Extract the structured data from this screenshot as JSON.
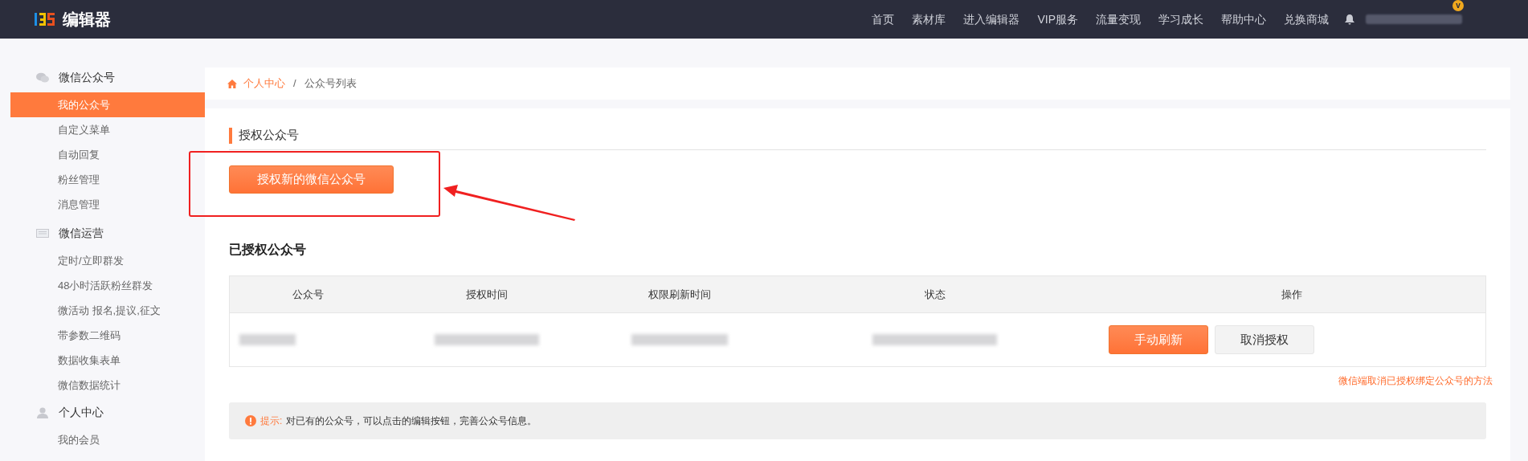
{
  "header": {
    "logo_text": "编辑器",
    "nav": [
      "首页",
      "素材库",
      "进入编辑器",
      "VIP服务",
      "流量变现",
      "学习成长",
      "帮助中心",
      "兑换商城"
    ],
    "vip_badge": "v"
  },
  "sidebar": {
    "groups": [
      {
        "kind": "wechat",
        "label": "微信公众号",
        "items": [
          {
            "label": "我的公众号",
            "selected": true
          },
          {
            "label": "自定义菜单",
            "selected": false
          },
          {
            "label": "自动回复",
            "selected": false
          },
          {
            "label": "粉丝管理",
            "selected": false
          },
          {
            "label": "消息管理",
            "selected": false
          }
        ]
      },
      {
        "kind": "mail",
        "label": "微信运营",
        "items": [
          {
            "label": "定时/立即群发",
            "selected": false
          },
          {
            "label": "48小时活跃粉丝群发",
            "selected": false
          },
          {
            "label": "微活动 报名,提议,征文",
            "selected": false
          },
          {
            "label": "带参数二维码",
            "selected": false
          },
          {
            "label": "数据收集表单",
            "selected": false
          },
          {
            "label": "微信数据统计",
            "selected": false
          }
        ]
      },
      {
        "kind": "user",
        "label": "个人中心",
        "items": [
          {
            "label": "我的会员",
            "selected": false
          }
        ]
      }
    ]
  },
  "breadcrumb": {
    "items": [
      "个人中心",
      "公众号列表"
    ],
    "separator": "/"
  },
  "authorize_section": {
    "title": "授权公众号",
    "button": "授权新的微信公众号"
  },
  "authorized_section": {
    "title": "已授权公众号",
    "table": {
      "columns": [
        "公众号",
        "授权时间",
        "权限刷新时间",
        "状态",
        "操作"
      ],
      "rows": [
        {
          "actions": [
            "手动刷新",
            "取消授权"
          ]
        }
      ]
    },
    "link": "微信端取消已授权绑定公众号的方法"
  },
  "tip": {
    "label": "提示:",
    "text": "对已有的公众号，可以点击的编辑按钮，完善公众号信息。"
  }
}
